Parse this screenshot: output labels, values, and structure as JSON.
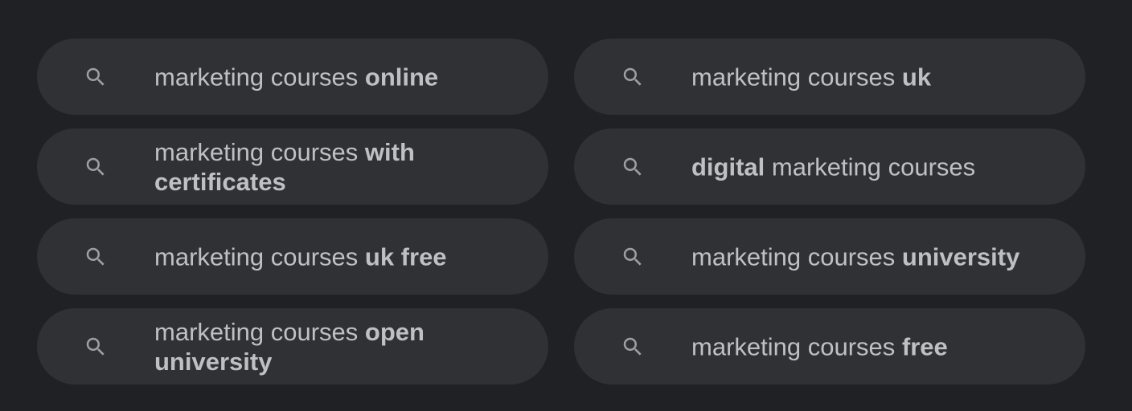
{
  "icon": "search-icon",
  "colors": {
    "background": "#202124",
    "chip": "#303134",
    "text": "#bdc1c6",
    "icon": "#9aa0a6"
  },
  "suggestions": [
    {
      "parts": [
        {
          "text": "marketing courses ",
          "bold": false
        },
        {
          "text": "online",
          "bold": true
        }
      ]
    },
    {
      "parts": [
        {
          "text": "marketing courses ",
          "bold": false
        },
        {
          "text": "uk",
          "bold": true
        }
      ]
    },
    {
      "parts": [
        {
          "text": "marketing courses ",
          "bold": false
        },
        {
          "text": "with certificates",
          "bold": true
        }
      ]
    },
    {
      "parts": [
        {
          "text": "digital",
          "bold": true
        },
        {
          "text": " marketing courses",
          "bold": false
        }
      ]
    },
    {
      "parts": [
        {
          "text": "marketing courses ",
          "bold": false
        },
        {
          "text": "uk free",
          "bold": true
        }
      ]
    },
    {
      "parts": [
        {
          "text": "marketing courses ",
          "bold": false
        },
        {
          "text": "university",
          "bold": true
        }
      ]
    },
    {
      "parts": [
        {
          "text": "marketing courses ",
          "bold": false
        },
        {
          "text": "open university",
          "bold": true
        }
      ]
    },
    {
      "parts": [
        {
          "text": "marketing courses ",
          "bold": false
        },
        {
          "text": "free",
          "bold": true
        }
      ]
    }
  ]
}
